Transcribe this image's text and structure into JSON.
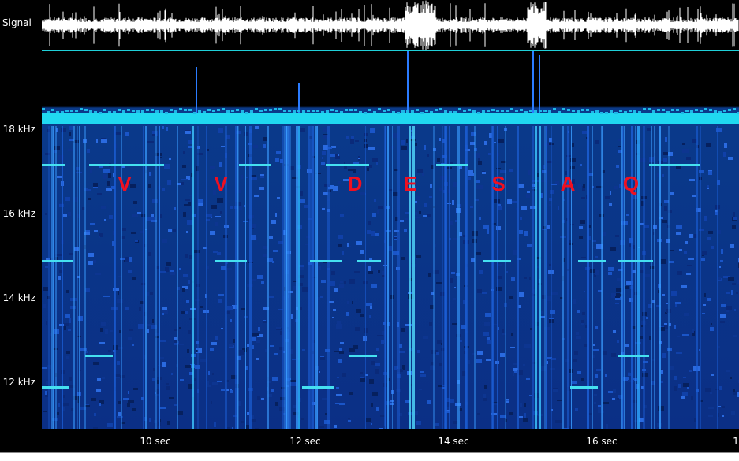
{
  "signal_panel": {
    "label": "Signal"
  },
  "frequency_axis": {
    "ticks": [
      {
        "label": "18 kHz",
        "value_khz": 18
      },
      {
        "label": "16 kHz",
        "value_khz": 16
      },
      {
        "label": "14 kHz",
        "value_khz": 14
      },
      {
        "label": "12 kHz",
        "value_khz": 12
      }
    ]
  },
  "time_axis": {
    "ticks": [
      {
        "label": "10  sec",
        "value_sec": 10
      },
      {
        "label": "12  sec",
        "value_sec": 12
      },
      {
        "label": "14  sec",
        "value_sec": 14
      },
      {
        "label": "16  sec",
        "value_sec": 16
      },
      {
        "label": "1",
        "value_sec": 18
      }
    ]
  },
  "annotations": {
    "letters": [
      "V",
      "V",
      "D",
      "E",
      "S",
      "A",
      "Q"
    ]
  },
  "colors": {
    "background": "#000000",
    "spectrogram_base": "#0b2f86",
    "band_highlight": "#20d8f0",
    "trace": "#ffffff",
    "annotation": "#f01020"
  }
}
